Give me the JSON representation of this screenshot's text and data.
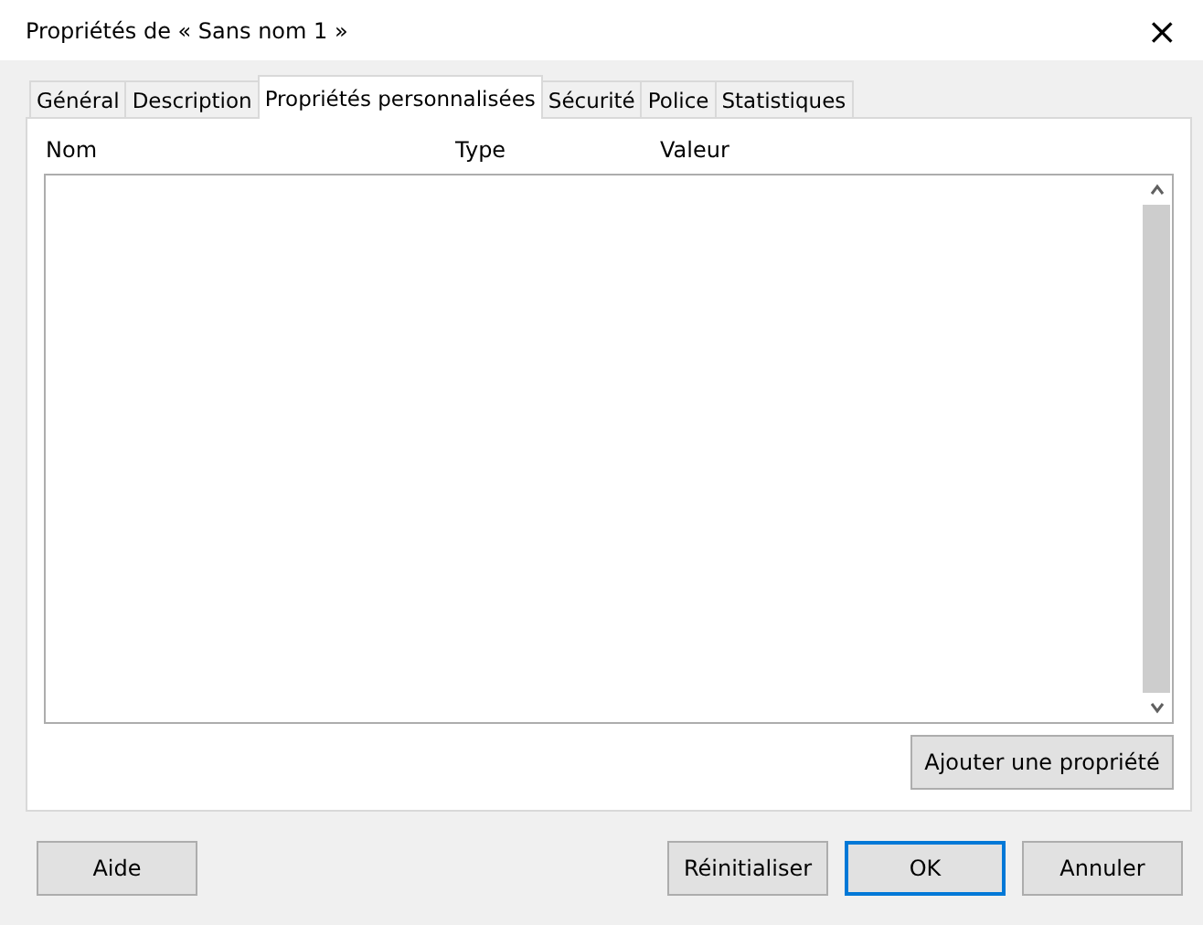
{
  "window": {
    "title": "Propriétés de « Sans nom 1 »",
    "close": "×"
  },
  "tabs": [
    {
      "label": "Général",
      "selected": false
    },
    {
      "label": "Description",
      "selected": false
    },
    {
      "label": "Propriétés personnalisées",
      "selected": true
    },
    {
      "label": "Sécurité",
      "selected": false
    },
    {
      "label": "Police",
      "selected": false
    },
    {
      "label": "Statistiques",
      "selected": false
    }
  ],
  "table": {
    "columns": [
      "Nom",
      "Type",
      "Valeur"
    ]
  },
  "add_button": "Ajouter une propriété",
  "buttons": [
    {
      "label": "Aide",
      "kind": "help",
      "default": false
    },
    {
      "label": "Réinitialiser",
      "kind": "action",
      "default": false
    },
    {
      "label": "OK",
      "kind": "action",
      "default": true
    },
    {
      "label": "Annuler",
      "kind": "action",
      "default": false
    }
  ]
}
